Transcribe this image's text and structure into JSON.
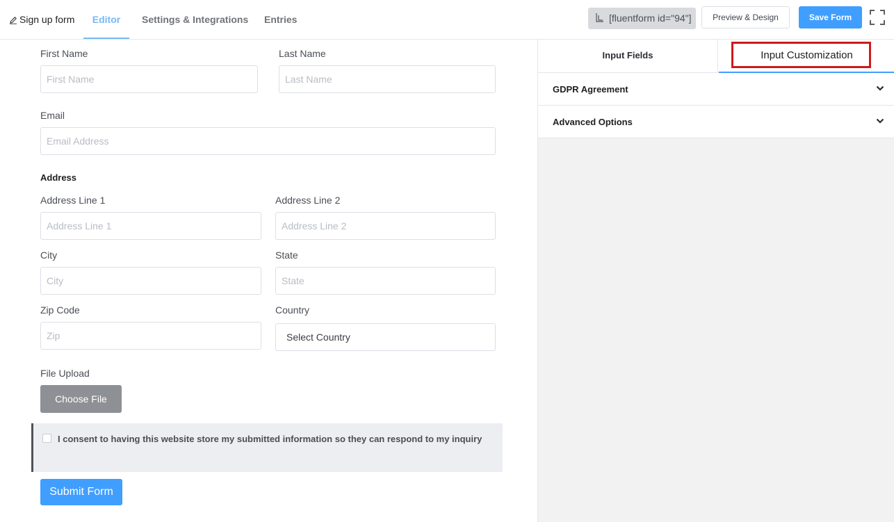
{
  "nav": {
    "form_title": "Sign up form",
    "tabs": [
      "Editor",
      "Settings & Integrations",
      "Entries"
    ],
    "shortcode": "[fluentform id=\"94\"]",
    "preview_label": "Preview & Design",
    "save_label": "Save Form"
  },
  "form": {
    "first_name": {
      "label": "First Name",
      "placeholder": "First Name"
    },
    "last_name": {
      "label": "Last Name",
      "placeholder": "Last Name"
    },
    "email": {
      "label": "Email",
      "placeholder": "Email Address"
    },
    "address": {
      "title": "Address",
      "line1": {
        "label": "Address Line 1",
        "placeholder": "Address Line 1"
      },
      "line2": {
        "label": "Address Line 2",
        "placeholder": "Address Line 2"
      },
      "city": {
        "label": "City",
        "placeholder": "City"
      },
      "state": {
        "label": "State",
        "placeholder": "State"
      },
      "zip": {
        "label": "Zip Code",
        "placeholder": "Zip"
      },
      "country": {
        "label": "Country",
        "value": "Select Country"
      }
    },
    "file_upload": {
      "label": "File Upload",
      "button": "Choose File"
    },
    "gdpr_text": "I consent to having this website store my submitted information so they can respond to my inquiry",
    "submit_label": "Submit Form"
  },
  "panel": {
    "tabs": [
      "Input Fields",
      "Input Customization"
    ],
    "accordions": [
      "GDPR Agreement",
      "Advanced Options"
    ]
  },
  "colors": {
    "accent": "#409eff",
    "highlight": "#cc1b1b",
    "editor_tab": "#76b9f5"
  }
}
